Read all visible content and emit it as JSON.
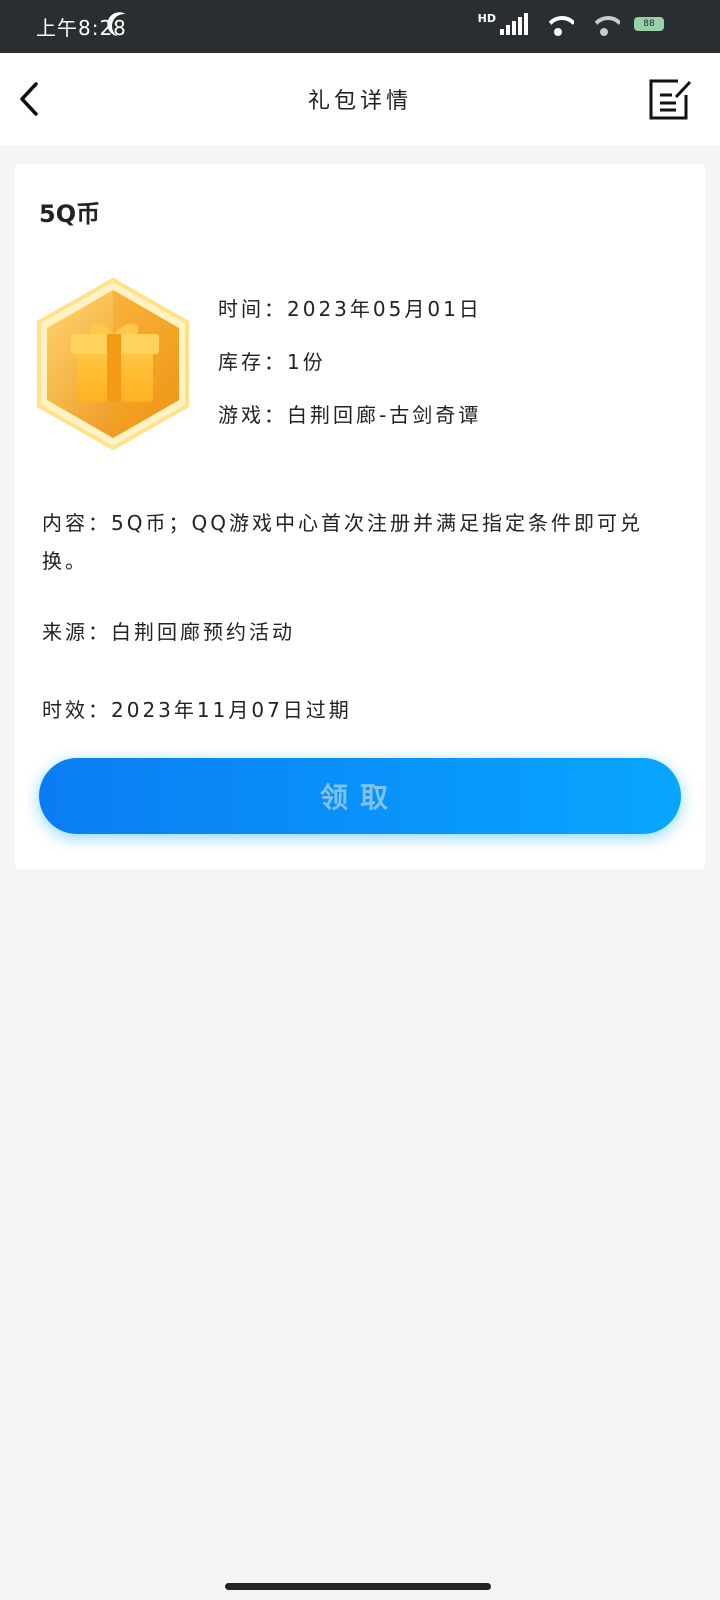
{
  "status_bar": {
    "time": "上午8:28",
    "network": "HD",
    "battery": "88"
  },
  "header": {
    "title": "礼包详情"
  },
  "gift": {
    "name": "5Q币",
    "time_label": "时间：",
    "time_value": "2023年05月01日",
    "stock_label": "库存：",
    "stock_value": "1份",
    "game_label": "游戏：",
    "game_value": "白荆回廊-古剑奇谭",
    "content": "内容：5Q币；QQ游戏中心首次注册并满足指定条件即可兑换。",
    "source_label": "来源：",
    "source_value": "白荆回廊预约活动",
    "expire_label": "时效：",
    "expire_value": "2023年11月07日过期",
    "claim_label": "领取"
  },
  "colors": {
    "accent": "#0a8cf8",
    "badge_gold": "#f5a623"
  }
}
